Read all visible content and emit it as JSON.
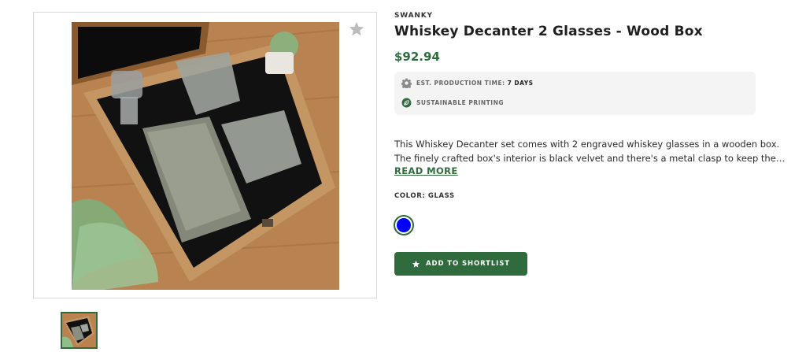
{
  "product": {
    "brand": "SWANKY",
    "title": "Whiskey Decanter 2 Glasses - Wood Box",
    "price": "$92.94"
  },
  "info": {
    "production_label": "EST. PRODUCTION TIME:",
    "production_value": "7 DAYS",
    "production_icon": "gear-icon",
    "sustainable_label": "SUSTAINABLE PRINTING",
    "sustainable_icon": "leaf-icon"
  },
  "description": {
    "line1": "This Whiskey Decanter set comes with 2 engraved whiskey glasses in a wooden box.",
    "line2": "The finely crafted box's interior is black velvet and there's a metal clasp to keep the…",
    "read_more": "READ MORE"
  },
  "color": {
    "label": "COLOR: GLASS",
    "selected_swatch": "#0000ff"
  },
  "actions": {
    "shortlist_label": "ADD TO SHORTLIST"
  },
  "colors": {
    "accent": "#2f6b3c",
    "info_bg": "#f4f4f4"
  }
}
